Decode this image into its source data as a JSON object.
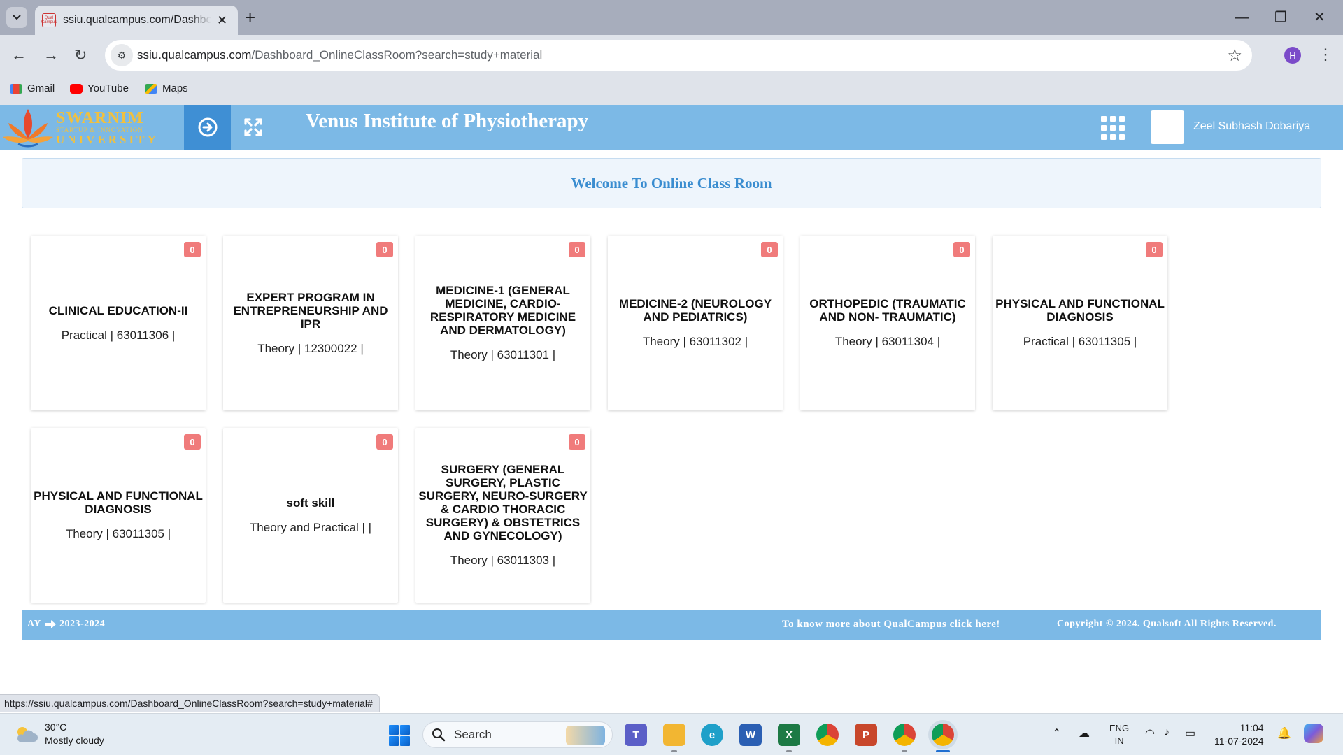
{
  "browser": {
    "tab_title": "ssiu.qualcampus.com/Dashboard_OnlineClassRoom?search=study+material",
    "favicon_text": "Qual Campus",
    "url_host": "ssiu.qualcampus.com",
    "url_path": "/Dashboard_OnlineClassRoom?search=study+material",
    "profile_initial": "H",
    "bookmarks": [
      {
        "label": "Gmail",
        "icon": "gmail-icon",
        "color": "#ea4335"
      },
      {
        "label": "YouTube",
        "icon": "youtube-icon",
        "color": "#ff0000"
      },
      {
        "label": "Maps",
        "icon": "maps-icon",
        "color": "#34a853"
      }
    ],
    "status_url": "https://ssiu.qualcampus.com/Dashboard_OnlineClassRoom?search=study+material#"
  },
  "header": {
    "logo": {
      "title": "SWARNIM",
      "subtitle": "STARTUP & INNOVATION",
      "univ": "UNIVERSITY"
    },
    "institute": "Venus Institute of Physiotherapy",
    "user_name": "Zeel Subhash Dobariya",
    "accent": "#7cb9e6",
    "toggle_bg": "#3f8fd4"
  },
  "welcome": {
    "text": "Welcome To Online Class Room"
  },
  "courses": [
    {
      "badge": "0",
      "title": "CLINICAL EDUCATION-II",
      "meta": "Practical | 63011306 |"
    },
    {
      "badge": "0",
      "title": "EXPERT PROGRAM IN ENTREPRENEURSHIP AND IPR",
      "meta": "Theory | 12300022 |"
    },
    {
      "badge": "0",
      "title": "MEDICINE-1 (GENERAL MEDICINE, CARDIO-RESPIRATORY MEDICINE AND DERMATOLOGY)",
      "meta": "Theory | 63011301 |"
    },
    {
      "badge": "0",
      "title": "MEDICINE-2 (NEUROLOGY AND PEDIATRICS)",
      "meta": "Theory | 63011302 |"
    },
    {
      "badge": "0",
      "title": "ORTHOPEDIC (TRAUMATIC AND NON- TRAUMATIC)",
      "meta": "Theory | 63011304 |"
    },
    {
      "badge": "0",
      "title": "PHYSICAL AND FUNCTIONAL DIAGNOSIS",
      "meta": "Practical | 63011305 |"
    },
    {
      "badge": "0",
      "title": "PHYSICAL AND FUNCTIONAL DIAGNOSIS",
      "meta": "Theory | 63011305 |"
    },
    {
      "badge": "0",
      "title": "soft skill",
      "meta": "Theory and Practical | |"
    },
    {
      "badge": "0",
      "title": "SURGERY (GENERAL SURGERY, PLASTIC SURGERY, NEURO-SURGERY & CARDIO THORACIC SURGERY) & OBSTETRICS AND GYNECOLOGY)",
      "meta": "Theory | 63011303 |"
    }
  ],
  "footer": {
    "ay_label": "AY",
    "ay_value": "2023-2024",
    "link_text": "To know more about QualCampus click here!",
    "copyright": "Copyright © 2024. Qualsoft All Rights Reserved."
  },
  "taskbar": {
    "weather_temp": "30°C",
    "weather_desc": "Mostly cloudy",
    "search_label": "Search",
    "lang_line1": "ENG",
    "lang_line2": "IN",
    "time": "11:04",
    "date": "11-07-2024",
    "apps": [
      {
        "name": "teams-icon",
        "color": "#5b5fc7",
        "glyph": "T"
      },
      {
        "name": "file-explorer-icon",
        "color": "#f2b632",
        "glyph": ""
      },
      {
        "name": "edge-icon",
        "color": "#1fa0c9",
        "glyph": "e"
      },
      {
        "name": "word-icon",
        "color": "#2b5fb3",
        "glyph": "W"
      },
      {
        "name": "excel-icon",
        "color": "#1d7a45",
        "glyph": "X"
      },
      {
        "name": "chrome-icon",
        "color": "#db4437",
        "glyph": ""
      },
      {
        "name": "powerpoint-icon",
        "color": "#c8472b",
        "glyph": "P"
      },
      {
        "name": "chrome-profile-icon",
        "color": "#db4437",
        "glyph": ""
      },
      {
        "name": "chrome-active-icon",
        "color": "#db4437",
        "glyph": ""
      }
    ]
  }
}
